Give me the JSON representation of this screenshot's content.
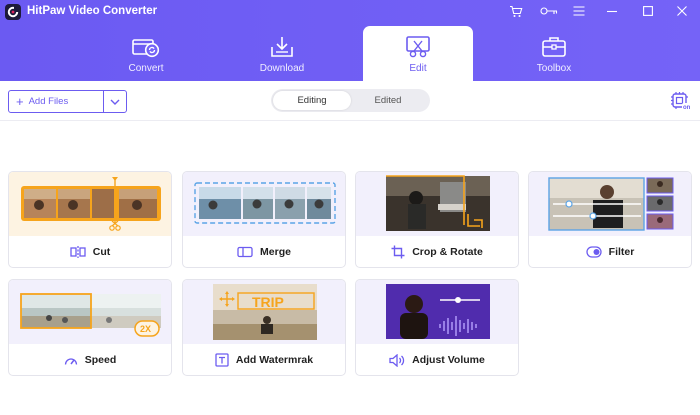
{
  "app": {
    "title": "HitPaw Video Converter"
  },
  "colors": {
    "accent": "#6c5cf0",
    "header": "#7060f4",
    "orange": "#f6a41c"
  },
  "window_icons": [
    "cart-icon",
    "key-icon",
    "menu-icon",
    "minimize-icon",
    "maximize-icon",
    "close-icon"
  ],
  "tabs": [
    {
      "label": "Convert",
      "icon": "convert-icon"
    },
    {
      "label": "Download",
      "icon": "download-icon"
    },
    {
      "label": "Edit",
      "icon": "edit-icon",
      "active": true
    },
    {
      "label": "Toolbox",
      "icon": "toolbox-icon"
    }
  ],
  "toolbar": {
    "add_files": "Add Files"
  },
  "segment": {
    "editing": "Editing",
    "edited": "Edited",
    "selected": "Editing"
  },
  "cards": [
    {
      "label": "Cut",
      "icon": "cut-icon"
    },
    {
      "label": "Merge",
      "icon": "merge-icon"
    },
    {
      "label": "Crop & Rotate",
      "icon": "crop-icon"
    },
    {
      "label": "Filter",
      "icon": "filter-icon"
    },
    {
      "label": "Speed",
      "icon": "speed-icon",
      "badge": "2X"
    },
    {
      "label": "Add Watermrak",
      "icon": "watermark-icon",
      "badge": "TRIP"
    },
    {
      "label": "Adjust Volume",
      "icon": "volume-icon"
    }
  ]
}
